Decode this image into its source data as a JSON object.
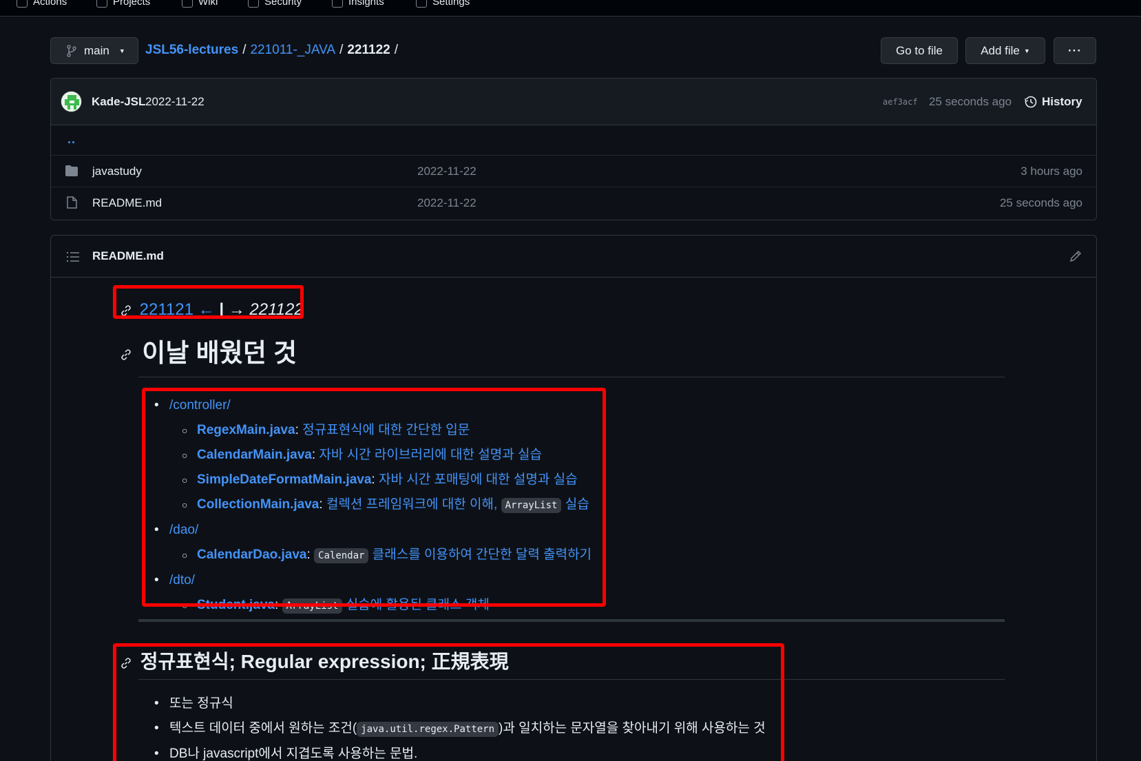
{
  "topnav": {
    "tabs": [
      "Actions",
      "Projects",
      "Wiki",
      "Security",
      "Insights",
      "Settings"
    ]
  },
  "toolbar": {
    "branch": "main",
    "breadcrumb": {
      "repo": "JSL56-lectures",
      "sep1": "/",
      "folder": "221011-_JAVA",
      "sep2": "/",
      "current": "221122",
      "sep3": "/"
    },
    "go_to_file": "Go to file",
    "add_file": "Add file",
    "more": "···"
  },
  "commit": {
    "author": "Kade-JSL",
    "message": "2022-11-22",
    "hash": "aef3acf",
    "time": "25 seconds ago",
    "history": "History"
  },
  "files": {
    "parent": "..",
    "rows": [
      {
        "name": "javastudy",
        "message": "2022-11-22",
        "time": "3 hours ago"
      },
      {
        "name": "README.md",
        "message": "2022-11-22",
        "time": "25 seconds ago"
      }
    ]
  },
  "readme": {
    "title": "README.md",
    "nav": {
      "prev": "221121 ←",
      "sep": "|",
      "next": "→ 221122"
    },
    "h1": "이날 배웠던 것",
    "list": [
      {
        "dir": "/controller/",
        "items": [
          {
            "name": "RegexMain.java",
            "desc_pre": "정규표현식에 대한 간단한 입문",
            "code": "",
            "desc_post": ""
          },
          {
            "name": "CalendarMain.java",
            "desc_pre": "자바 시간 라이브러리에 대한 설명과 실습",
            "code": "",
            "desc_post": ""
          },
          {
            "name": "SimpleDateFormatMain.java",
            "desc_pre": "자바 시간 포매팅에 대한 설명과 실습",
            "code": "",
            "desc_post": ""
          },
          {
            "name": "CollectionMain.java",
            "desc_pre": "컬렉션 프레임워크에 대한 이해, ",
            "code": "ArrayList",
            "desc_post": " 실습"
          }
        ]
      },
      {
        "dir": "/dao/",
        "items": [
          {
            "name": "CalendarDao.java",
            "desc_pre": "",
            "code": "Calendar",
            "desc_post": " 클래스를 이용하여 간단한 달력 출력하기"
          }
        ]
      },
      {
        "dir": "/dto/",
        "items": [
          {
            "name": "Student.java",
            "desc_pre": "",
            "code": "ArrayList",
            "desc_post": " 실습에 활용된 클래스 객체"
          }
        ]
      }
    ],
    "h2": "정규표현식; Regular expression; 正規表現",
    "list2": {
      "item1": "또는 정규식",
      "item2_pre": "텍스트 데이터 중에서 원하는 조건(",
      "item2_code": "java.util.regex.Pattern",
      "item2_post": ")과 일치하는 문자열을 찾아내기 위해 사용하는 것",
      "item3": "DB나 javascript에서 지겹도록 사용하는 문법."
    }
  },
  "colors": {
    "background": "#0d1117",
    "link": "#4493f8",
    "highlight": "#ff0000",
    "muted": "#7d8590"
  }
}
